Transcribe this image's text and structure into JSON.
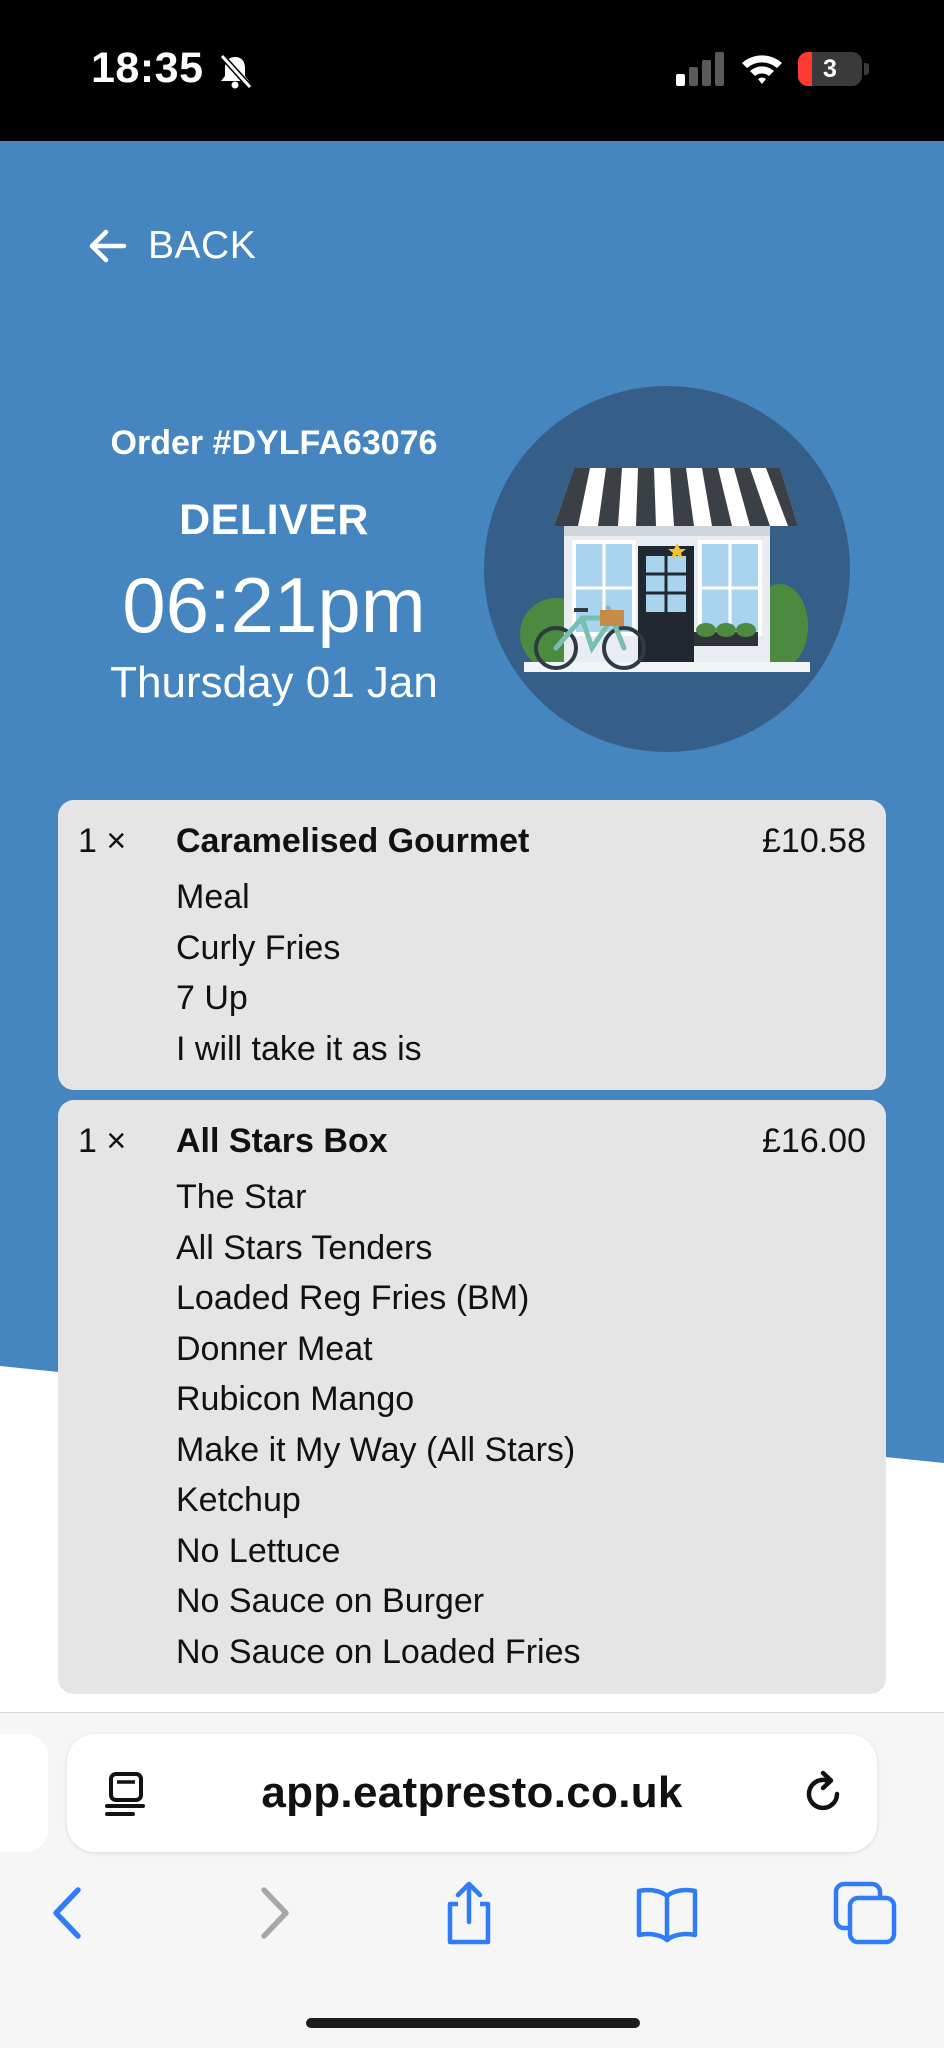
{
  "status_bar": {
    "time": "18:35",
    "battery_level": "3",
    "bell_icon": "bell-slash-icon",
    "signal_icon": "cellular-signal-icon",
    "wifi_icon": "wifi-icon"
  },
  "colors": {
    "brand_blue": "#4686c0",
    "card_bg": "#e5e5e5",
    "ios_blue": "#2f7cf6"
  },
  "header": {
    "back_label": "BACK",
    "back_icon": "arrow-left-icon"
  },
  "order": {
    "number": "Order #DYLFA63076",
    "mode": "DELIVER",
    "time": "06:21pm",
    "date": "Thursday 01 Jan",
    "illustration_icon": "shop-front-icon"
  },
  "items": [
    {
      "qty": "1 ×",
      "name": "Caramelised Gourmet",
      "price": "£10.58",
      "modifiers": [
        "Meal",
        "Curly Fries",
        "7 Up",
        "I will take it as is"
      ]
    },
    {
      "qty": "1 ×",
      "name": "All Stars Box",
      "price": "£16.00",
      "modifiers": [
        "The Star",
        "All Stars Tenders",
        "Loaded Reg Fries (BM)",
        "Donner Meat",
        "Rubicon Mango",
        "Make it My Way (All Stars)",
        "Ketchup",
        "No Lettuce",
        "No Sauce on Burger",
        "No Sauce on Loaded Fries"
      ]
    }
  ],
  "browser": {
    "url": "app.eatpresto.co.uk",
    "reader_icon": "reader-mode-icon",
    "reload_icon": "reload-icon",
    "nav_icons": [
      "chevron-left-icon",
      "chevron-right-icon",
      "share-icon",
      "book-icon",
      "tabs-icon"
    ]
  }
}
